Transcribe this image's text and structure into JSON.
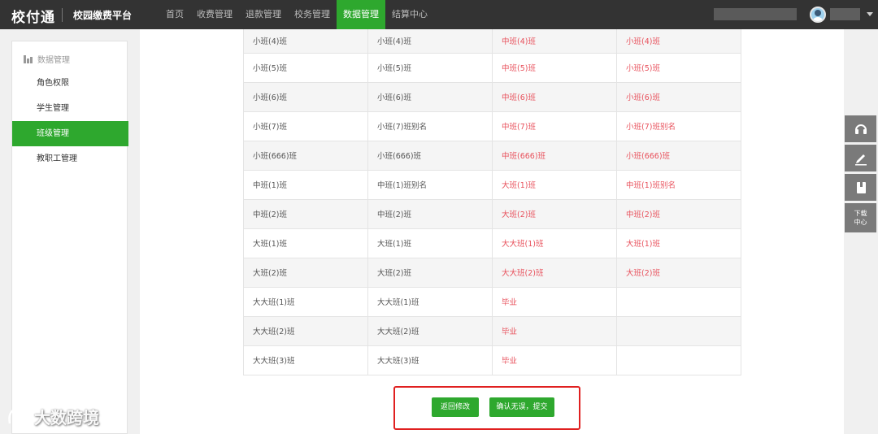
{
  "header": {
    "logo": "校付通",
    "platform": "校园缴费平台",
    "nav": [
      "首页",
      "收费管理",
      "退款管理",
      "校务管理",
      "数据管理",
      "结算中心"
    ],
    "active_nav": "数据管理"
  },
  "sidebar": {
    "section": "数据管理",
    "items": [
      {
        "label": "角色权限",
        "active": false
      },
      {
        "label": "学生管理",
        "active": false
      },
      {
        "label": "班级管理",
        "active": true
      },
      {
        "label": "教职工管理",
        "active": false
      }
    ]
  },
  "table": {
    "rows": [
      [
        "小班(4)班",
        "小班(4)班",
        "中班(4)班",
        "小班(4)班"
      ],
      [
        "小班(5)班",
        "小班(5)班",
        "中班(5)班",
        "小班(5)班"
      ],
      [
        "小班(6)班",
        "小班(6)班",
        "中班(6)班",
        "小班(6)班"
      ],
      [
        "小班(7)班",
        "小班(7)班别名",
        "中班(7)班",
        "小班(7)班别名"
      ],
      [
        "小班(666)班",
        "小班(666)班",
        "中班(666)班",
        "小班(666)班"
      ],
      [
        "中班(1)班",
        "中班(1)班别名",
        "大班(1)班",
        "中班(1)班别名"
      ],
      [
        "中班(2)班",
        "中班(2)班",
        "大班(2)班",
        "中班(2)班"
      ],
      [
        "大班(1)班",
        "大班(1)班",
        "大大班(1)班",
        "大班(1)班"
      ],
      [
        "大班(2)班",
        "大班(2)班",
        "大大班(2)班",
        "大班(2)班"
      ],
      [
        "大大班(1)班",
        "大大班(1)班",
        "毕业",
        ""
      ],
      [
        "大大班(2)班",
        "大大班(2)班",
        "毕业",
        ""
      ],
      [
        "大大班(3)班",
        "大大班(3)班",
        "毕业",
        ""
      ]
    ]
  },
  "actions": {
    "back": "返回修改",
    "confirm": "确认无误，提交"
  },
  "tools": {
    "download": "下载\n中心",
    "download_line1": "下载",
    "download_line2": "中心"
  },
  "watermark": "大数跨境",
  "colors": {
    "accent": "#2ea82e",
    "topbar": "#333333",
    "highlight_border": "#e02020",
    "changed_text": "#e8505b"
  }
}
